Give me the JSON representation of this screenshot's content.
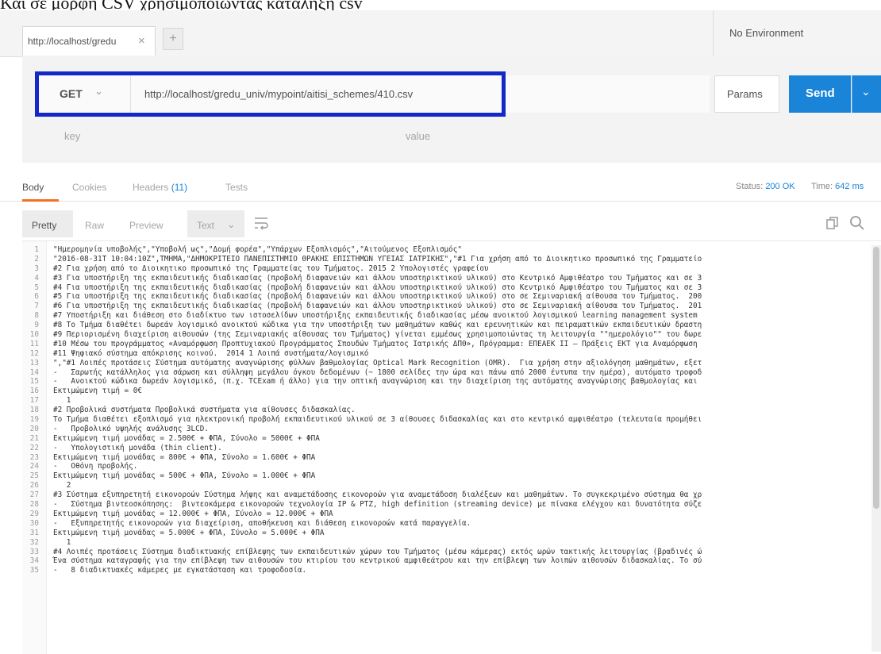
{
  "caption": "Και σε μορφή CSV χρησιμοποιώντας κατάληξη csv",
  "tabs": [
    {
      "label": "http://localhost/gredu"
    }
  ],
  "tab_close": "×",
  "new_tab": "+",
  "environment": {
    "label": "No Environment"
  },
  "request": {
    "method": "GET",
    "url": "http://localhost/gredu_univ/mypoint/aitisi_schemes/410.csv",
    "params_label": "Params",
    "send_label": "Send"
  },
  "kv": {
    "key_placeholder": "key",
    "value_placeholder": "value"
  },
  "response_tabs": {
    "body": "Body",
    "cookies": "Cookies",
    "headers": "Headers",
    "headers_count": "(11)",
    "tests": "Tests"
  },
  "status": {
    "label": "Status:",
    "value": "200 OK",
    "time_label": "Time:",
    "time_value": "642 ms"
  },
  "view_modes": {
    "pretty": "Pretty",
    "raw": "Raw",
    "preview": "Preview",
    "format": "Text"
  },
  "code_lines": [
    {
      "n": "1",
      "t": "\"Ημερομηνία υποβολής\",\"Υποβολή ως\",\"Δομή φορέα\",\"Υπάρχων Εξοπλισμός\",\"Αιτούμενος Εξοπλισμός\""
    },
    {
      "n": "2",
      "t": "\"2016-08-31T 10:04:10Z\",ΤΜΗΜΑ,\"ΔΗΜΟΚΡΙΤΕΙΟ ΠΑΝΕΠΙΣΤΗΜΙΟ ΘΡΑΚΗΣ ΕΠΙΣΤΗΜΩΝ ΥΓΕΙΑΣ ΙΑΤΡΙΚΗΣ\",\"#1 Για χρήση από το Διοικητικο προσωπικό της Γραμματείο"
    },
    {
      "n": "3",
      "t": "#2 Για χρήση από το Διοικητικο προσωπικό της Γραμματείας του Τμήματος. 2015 2 Υπολογιστές γραφείου"
    },
    {
      "n": "4",
      "t": "#3 Για υποστήριξη της εκπαιδευτικής διαδικασίας (προβολή διαφανειών και άλλου υποστηρικτικού υλικού) στο Κεντρικό Αμφιθέατρο του Τμήματος και σε 3"
    },
    {
      "n": "5",
      "t": "#4 Για υποστήριξη της εκπαιδευτικής διαδικασίας (προβολή διαφανειών και άλλου υποστηρικτικού υλικού) στο Κεντρικό Αμφιθέατρο του Τμήματος και σε 3"
    },
    {
      "n": "6",
      "t": "#5 Για υποστήριξη της εκπαιδευτικής διαδικασίας (προβολή διαφανειών και άλλου υποστηρικτικού υλικού) στο σε Σεμιναριακή αίθουσα του Τμήματος.  200"
    },
    {
      "n": "7",
      "t": "#6 Για υποστήριξη της εκπαιδευτικής διαδικασίας (προβολή διαφανειών και άλλου υποστηρικτικού υλικού) στο σε Σεμιναριακή αίθουσα του Τμήματος.  201"
    },
    {
      "n": "8",
      "t": "#7 Υποστήριξη και διάθεση στο διαδίκτυο των ιστοσελίδων υποστήριξης εκπαιδευτικής διαδικασίας μέσω ανοικτού λογισμικού learning management system"
    },
    {
      "n": "9",
      "t": "#8 Το Τμήμα διαθέτει δωρεάν λογισμικό ανοικτού κώδικα για την υποστήριξη των μαθημάτων καθώς και ερευνητικών και πειραματικών εκπαιδευτικών δραστη"
    },
    {
      "n": "10",
      "t": "#9 Περιορισμένη διαχείριση αιθουσών (της Σεμιναριακής αίθουσας του Τμήματος) γίνεται εμμέσως χρησιμοποιώντας τη λειτουργία \"\"ημερολόγιο\"\" του δωρε"
    },
    {
      "n": "11",
      "t": "#10 Μέσω του προγράμματος «Αναμόρφωση Προπτυχιακού Προγράμματος Σπουδών Τμήματος Ιατρικής ΔΠΘ», Πρόγραμμα: ΕΠΕΑΕΚ ΙΙ – Πράξεις ΕΚΤ για Αναμόρφωση"
    },
    {
      "n": "12",
      "t": "#11 Ψηφιακό σύστημα απόκρισης κοινού.  2014 1 Λοιπά συστήματα/λογισμικό"
    },
    {
      "n": "13",
      "t": "\",\"#1 Λοιπές προτάσεις Σύστημα αυτόματης αναγνώρισης φύλλων βαθμολογίας Optical Mark Recognition (OMR).  Για χρήση στην αξιολόγηση μαθημάτων, εξετ"
    },
    {
      "n": "14",
      "t": "-   Σαρωτής κατάλληλος για σάρωση και σύλληψη μεγάλου όγκου δεδομένων (~ 1800 σελίδες την ώρα και πάνω από 2000 έντυπα την ημέρα), αυτόματο τροφοδ"
    },
    {
      "n": "15",
      "t": "-   Ανοικτού κώδικα δωρεάν λογισμικό, (π.χ. TCExam ή άλλο) για την οπτική αναγνώριση και την διαχείριση της αυτόματης αναγνώρισης βαθμολογίας και"
    },
    {
      "n": "16",
      "t": "Εκτιμώμενη τιμή = 0€"
    },
    {
      "n": "17",
      "t": "   1"
    },
    {
      "n": "18",
      "t": "#2 Προβολικά συστήματα Προβολικά συστήματα για αίθουσες διδασκαλίας."
    },
    {
      "n": "19",
      "t": "Το Τμήμα διαθέτει εξοπλισμό για ηλεκτρονική προβολή εκπαιδευτικού υλικού σε 3 αίθουσες διδασκαλίας και στο κεντρικό αμφιθέατρο (τελευταία προμήθει"
    },
    {
      "n": "20",
      "t": "-   Προβολικό υψηλής ανάλυσης 3LCD."
    },
    {
      "n": "21",
      "t": "Εκτιμώμενη τιμή μονάδας = 2.500€ + ΦΠΑ, Σύνολο = 5000€ + ΦΠΑ"
    },
    {
      "n": "22",
      "t": "-   Υπολογιστική μονάδα (thin client)."
    },
    {
      "n": "23",
      "t": "Εκτιμώμενη τιμή μονάδας = 800€ + ΦΠΑ, Σύνολο = 1.600€ + ΦΠΑ"
    },
    {
      "n": "24",
      "t": "-   Οθόνη προβολής."
    },
    {
      "n": "25",
      "t": "Εκτιμώμενη τιμή μονάδας = 500€ + ΦΠΑ, Σύνολο = 1.000€ + ΦΠΑ"
    },
    {
      "n": "26",
      "t": "   2"
    },
    {
      "n": "27",
      "t": "#3 Σύστημα εξυπηρετητή εικονορoών Σύστημα λήψης και αναμετάδοσης εικονορoών για αναμετάδοση διαλέξεων και μαθημάτων. Το συγκεκριμένο σύστημα θα χρ"
    },
    {
      "n": "28",
      "t": "-   Σύστημα βιντεοσκόπησης:  βιντεοκάμερα εικονορoών τεχνολογία IP & PTZ, high definition (streaming device) με πίνακα ελέγχου και δυνατότητα σύζε"
    },
    {
      "n": "29",
      "t": "Εκτιμώμενη τιμή μονάδας = 12.000€ + ΦΠΑ, Σύνολο = 12.000€ + ΦΠΑ"
    },
    {
      "n": "30",
      "t": "-   Εξυπηρετητής εικονορoών για διαχείριση, αποθήκευση και διάθεση εικονορoών κατά παραγγελία."
    },
    {
      "n": "31",
      "t": "Εκτιμώμενη τιμή μονάδας = 5.000€ + ΦΠΑ, Σύνολο = 5.000€ + ΦΠΑ"
    },
    {
      "n": "32",
      "t": "   1"
    },
    {
      "n": "33",
      "t": "#4 Λοιπές προτάσεις Σύστημα διαδικτυακής επίβλεψης των εκπαιδευτικών χώρων του Τμήματος (μέσω κάμερας) εκτός ωρών τακτικής λειτουργίας (βραδινές ώ"
    },
    {
      "n": "34",
      "t": "Ένα σύστημα καταγραφής για την επίβλεψη των αιθουσών του κτιρίου του κεντρικού αμφιθεάτρου και την επίβλεψη των λοιπών αιθουσών διδασκαλίας. Το σύ"
    },
    {
      "n": "35",
      "t": "-   8 διαδικτυακές κάμερες με εγκατάσταση και τροφοδοσία."
    }
  ]
}
